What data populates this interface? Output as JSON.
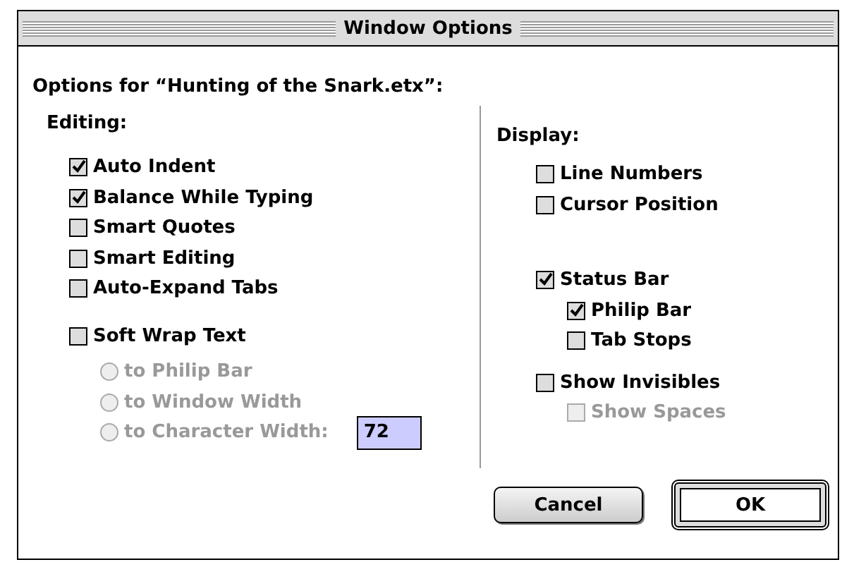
{
  "window": {
    "title": "Window Options"
  },
  "subtitle": "Options for “Hunting of the Snark.etx”:",
  "editing": {
    "heading": "Editing:",
    "options": [
      {
        "label": "Auto Indent",
        "checked": true
      },
      {
        "label": "Balance While Typing",
        "checked": true
      },
      {
        "label": "Smart Quotes",
        "checked": false
      },
      {
        "label": "Smart Editing",
        "checked": false
      },
      {
        "label": "Auto-Expand Tabs",
        "checked": false
      }
    ],
    "soft_wrap": {
      "label": "Soft Wrap Text",
      "checked": false
    },
    "wrap_modes": [
      {
        "label": "to Philip Bar",
        "selected": false,
        "disabled": true
      },
      {
        "label": "to Window Width",
        "selected": false,
        "disabled": true
      },
      {
        "label": "to Character Width:",
        "selected": false,
        "disabled": true
      }
    ],
    "character_width": {
      "value": "72"
    }
  },
  "display": {
    "heading": "Display:",
    "groups": [
      [
        {
          "label": "Line Numbers",
          "checked": false,
          "disabled": false
        },
        {
          "label": "Cursor Position",
          "checked": false,
          "disabled": false
        }
      ],
      [
        {
          "label": "Status Bar",
          "checked": true,
          "disabled": false,
          "children": [
            {
              "label": "Philip Bar",
              "checked": true,
              "disabled": false
            },
            {
              "label": "Tab Stops",
              "checked": false,
              "disabled": false
            }
          ]
        },
        {
          "label": "Show Invisibles",
          "checked": false,
          "disabled": false,
          "children": [
            {
              "label": "Show Spaces",
              "checked": false,
              "disabled": true
            }
          ]
        }
      ]
    ]
  },
  "buttons": [
    {
      "label": "Cancel",
      "default": false
    },
    {
      "label": "OK",
      "default": true
    }
  ]
}
